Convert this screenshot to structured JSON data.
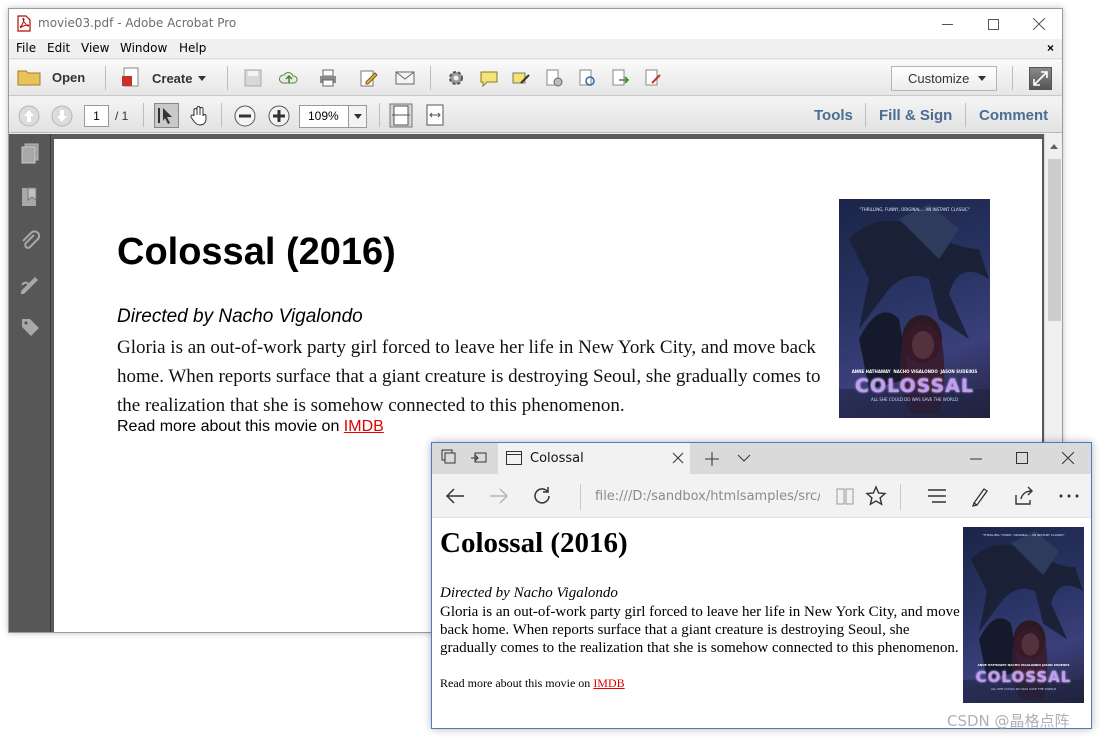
{
  "acrobat": {
    "window_title": "movie03.pdf - Adobe Acrobat Pro",
    "menu": [
      "File",
      "Edit",
      "View",
      "Window",
      "Help"
    ],
    "close_doc_glyph": "×",
    "toolbar": {
      "open_label": "Open",
      "create_label": "Create",
      "customize_label": "Customize"
    },
    "nav": {
      "page_current": "1",
      "page_total": "/ 1",
      "zoom": "109%",
      "tools_link": "Tools",
      "fill_sign_link": "Fill & Sign",
      "comment_link": "Comment"
    },
    "document": {
      "title": "Colossal (2016)",
      "director": "Directed by Nacho Vigalondo",
      "synopsis": "Gloria is an out-of-work party girl forced to leave her life in New York City, and move back home. When reports surface that a giant creature is destroying Seoul, she gradually comes to the realization that she is somehow connected to this phenomenon.",
      "read_more_prefix": "Read more about this movie on ",
      "read_more_link": "IMDB"
    }
  },
  "poster": {
    "tagline": "\"THRILLING, FUNNY, ORIGINAL... AN INSTANT CLASSIC\"",
    "names_left": "ANNE HATHAWAY",
    "names_mid": "NACHO VIGALONDO",
    "names_right": "JASON SUDEIKIS",
    "title_art": "COLOSSAL",
    "bottom_line": "ALL SHE COULD DO WAS SAVE THE WORLD"
  },
  "edge": {
    "tab_title": "Colossal",
    "url": "file:///D:/sandbox/htmlsamples/src/ma",
    "document": {
      "title": "Colossal (2016)",
      "director": "Directed by Nacho Vigalondo",
      "synopsis": "Gloria is an out-of-work party girl forced to leave her life in New York City, and move back home. When reports surface that a giant creature is destroying Seoul, she gradually comes to the realization that she is somehow connected to this phenomenon.",
      "read_more_prefix": "Read more about this movie on ",
      "read_more_link": "IMDB"
    }
  },
  "watermark": "CSDN @晶格点阵",
  "colors": {
    "link": "#e00000",
    "acrobat_link_blue": "#4a6d92",
    "edge_border": "#4a7ec2"
  }
}
